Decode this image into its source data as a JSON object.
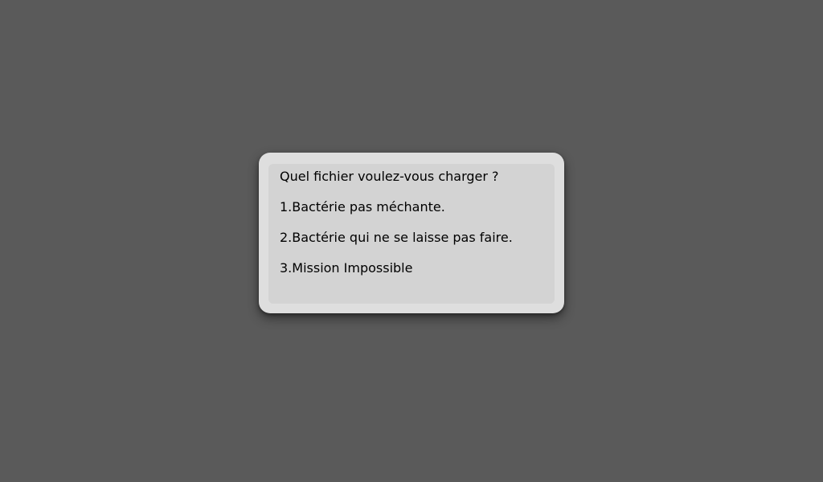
{
  "dialog": {
    "prompt": "Quel fichier voulez-vous charger ?",
    "options": [
      "1.Bactérie pas méchante.",
      "2.Bactérie qui ne se laisse pas faire.",
      "3.Mission Impossible"
    ]
  },
  "colors": {
    "background": "#5a5a5a",
    "dialog": "#dedede",
    "dialog_inner": "#d3d3d3",
    "text": "#000000"
  }
}
